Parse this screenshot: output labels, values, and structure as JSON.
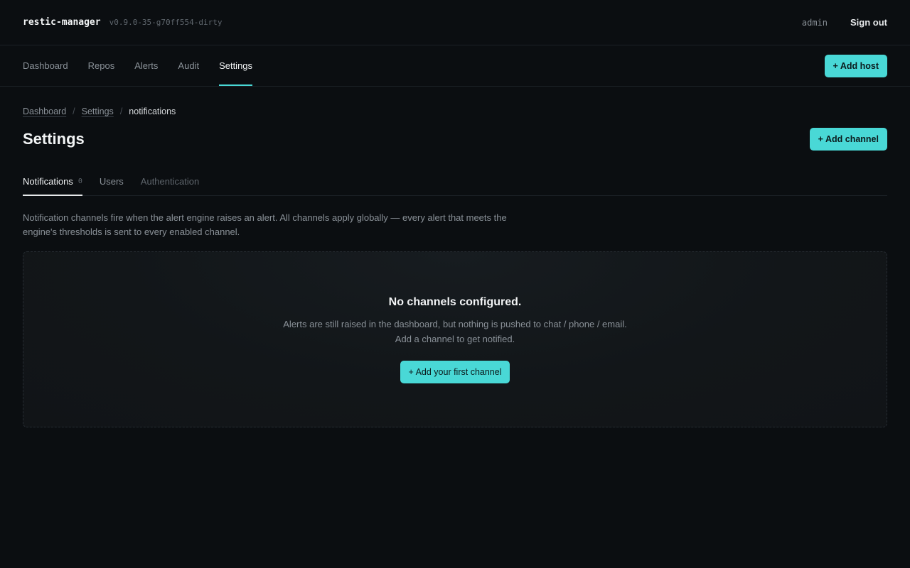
{
  "header": {
    "app_name": "restic-manager",
    "version": "v0.9.0-35-g70ff554-dirty",
    "username": "admin",
    "signout_label": "Sign out"
  },
  "nav": {
    "links": [
      {
        "label": "Dashboard"
      },
      {
        "label": "Repos"
      },
      {
        "label": "Alerts"
      },
      {
        "label": "Audit"
      },
      {
        "label": "Settings",
        "active": true
      }
    ],
    "add_host_label": "+ Add host"
  },
  "breadcrumb": {
    "items": [
      "Dashboard",
      "Settings"
    ],
    "separator": "/",
    "current": "notifications"
  },
  "page": {
    "title": "Settings",
    "add_channel_label": "+ Add channel"
  },
  "tabs": [
    {
      "label": "Notifications",
      "count": "0",
      "active": true
    },
    {
      "label": "Users"
    },
    {
      "label": "Authentication",
      "muted": true
    }
  ],
  "description": "Notification channels fire when the alert engine raises an alert. All channels apply globally — every alert that meets the engine's thresholds is sent to every enabled channel.",
  "empty_state": {
    "title": "No channels configured.",
    "text": "Alerts are still raised in the dashboard, but nothing is pushed to chat / phone / email. Add a channel to get notified.",
    "button_label": "+ Add your first channel"
  },
  "colors": {
    "accent": "#49d8d6",
    "background": "#0b0e11"
  }
}
